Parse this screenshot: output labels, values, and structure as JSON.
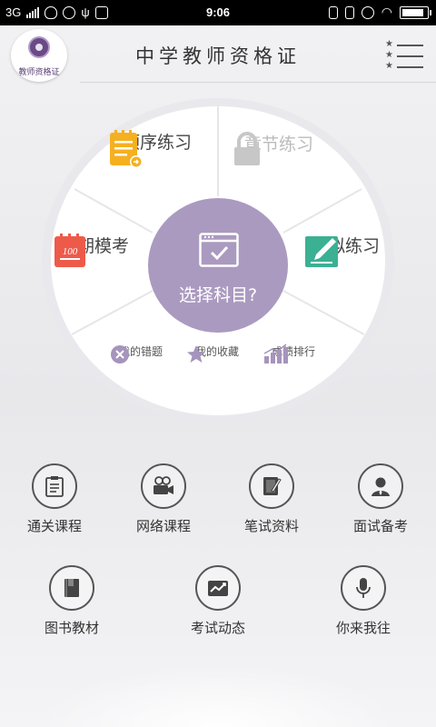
{
  "status_bar": {
    "network": "3G",
    "time": "9:06",
    "battery_level": 0.9
  },
  "header": {
    "logo_text": "教师资格证",
    "title": "中学教师资格证",
    "menu_icon": "star-list-menu-icon"
  },
  "wheel": {
    "center_label": "选择科目?",
    "segments": [
      {
        "label": "顺序练习",
        "icon": "notepad-arrow-icon",
        "enabled": true
      },
      {
        "label": "章节练习",
        "icon": "lock-icon",
        "enabled": false
      },
      {
        "label": "定期模考",
        "icon": "score-calendar-icon",
        "enabled": true
      },
      {
        "label": "模拟练习",
        "icon": "edit-pencil-icon",
        "enabled": true
      }
    ],
    "shortcuts": [
      {
        "label": "我的错题",
        "icon": "wrong-x-icon"
      },
      {
        "label": "我的收藏",
        "icon": "star-icon"
      },
      {
        "label": "成绩排行",
        "icon": "rank-chart-icon"
      }
    ]
  },
  "grid": [
    {
      "label": "通关课程",
      "icon": "clipboard-icon"
    },
    {
      "label": "网络课程",
      "icon": "video-camera-icon"
    },
    {
      "label": "笔试资料",
      "icon": "notebook-pen-icon"
    },
    {
      "label": "面试备考",
      "icon": "person-icon"
    },
    {
      "label": "图书教材",
      "icon": "book-icon"
    },
    {
      "label": "考试动态",
      "icon": "trend-chart-icon"
    },
    {
      "label": "你来我往",
      "icon": "microphone-icon"
    }
  ],
  "colors": {
    "accent_purple": "#ab9ac0",
    "notepad_orange": "#f5b020",
    "calendar_red": "#ee5a4a",
    "edit_teal": "#3bb093"
  }
}
